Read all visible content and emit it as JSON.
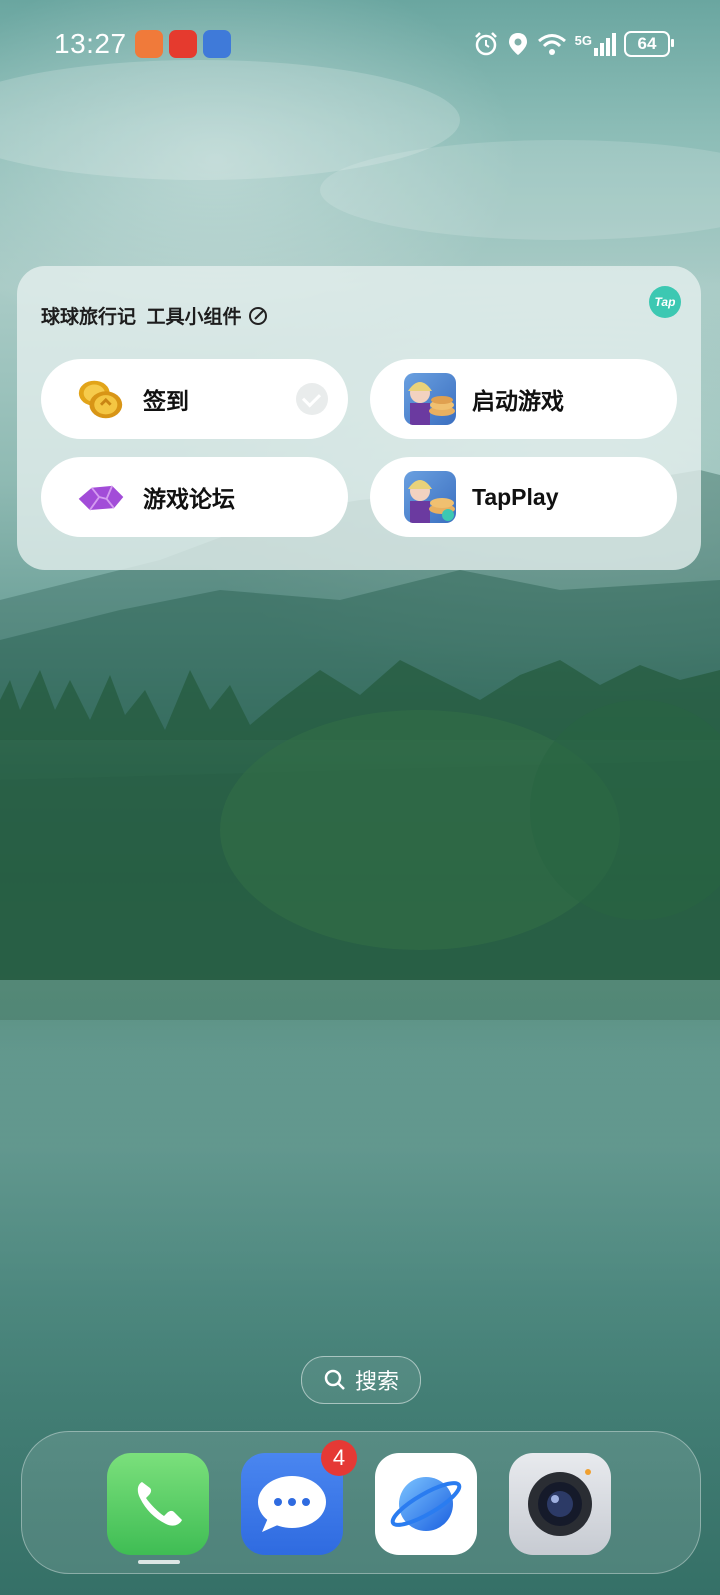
{
  "status_bar": {
    "time": "13:27",
    "notification_icons": [
      "health-app-icon",
      "lucky-app-icon",
      "weather-icon"
    ],
    "system_icons": [
      "alarm-icon",
      "location-icon",
      "wifi-icon",
      "5g-signal-icon"
    ],
    "network_label": "5G",
    "battery": "64"
  },
  "widget": {
    "title": "球球旅行记  工具小组件",
    "brand": "Tap",
    "items": [
      {
        "label": "签到",
        "icon": "gold-coins-icon",
        "checked": true
      },
      {
        "label": "启动游戏",
        "icon": "game-character-icon"
      },
      {
        "label": "游戏论坛",
        "icon": "purple-gem-icon"
      },
      {
        "label": "TapPlay",
        "icon": "game-character-icon"
      }
    ]
  },
  "search": {
    "label": "搜索"
  },
  "dock": {
    "apps": [
      {
        "name": "phone",
        "icon": "phone-icon"
      },
      {
        "name": "messages",
        "icon": "message-icon",
        "badge": "4"
      },
      {
        "name": "browser",
        "icon": "planet-icon"
      },
      {
        "name": "camera",
        "icon": "camera-icon"
      }
    ]
  }
}
